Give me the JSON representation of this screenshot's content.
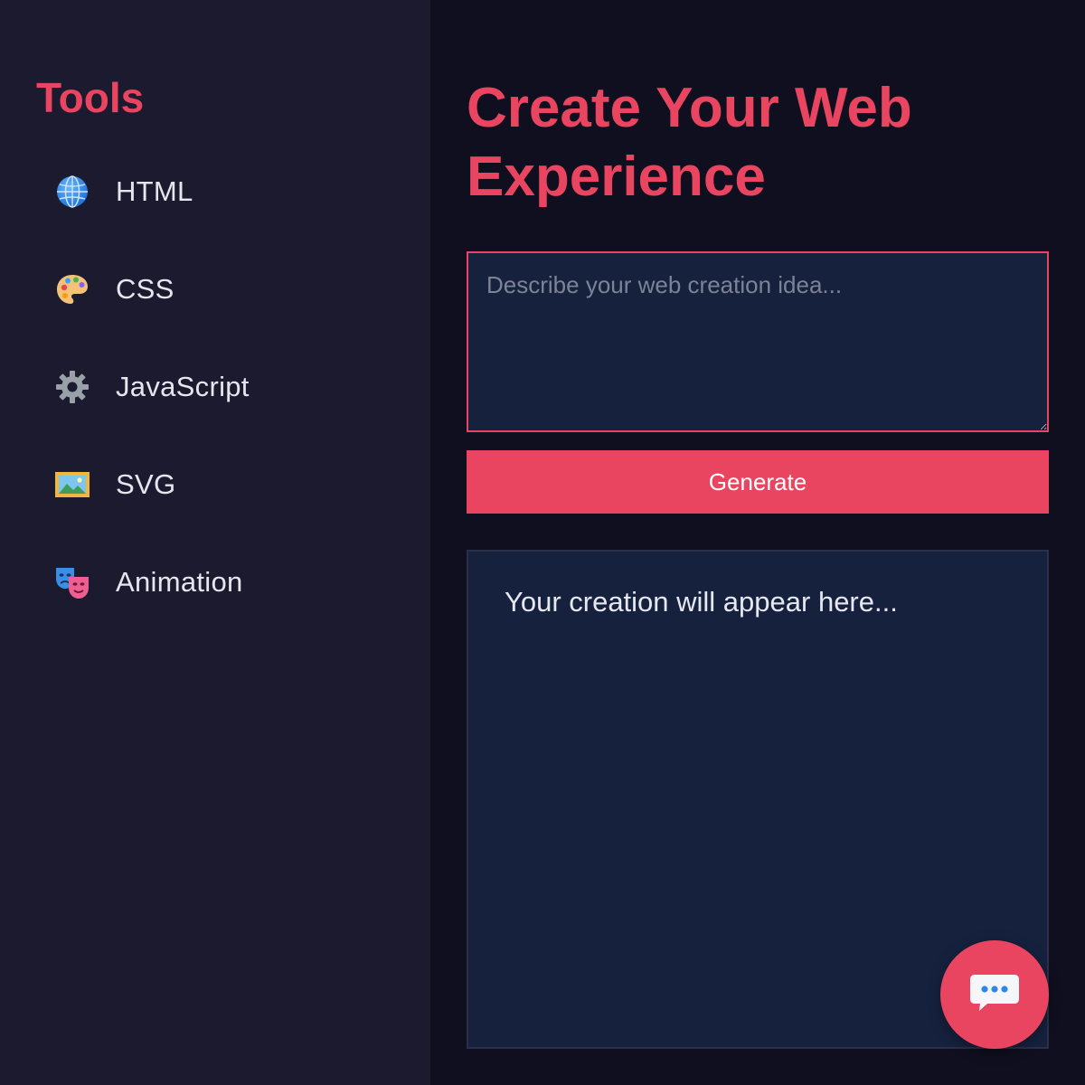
{
  "sidebar": {
    "title": "Tools",
    "items": [
      {
        "label": "HTML",
        "icon": "globe-icon"
      },
      {
        "label": "CSS",
        "icon": "palette-icon"
      },
      {
        "label": "JavaScript",
        "icon": "gear-icon"
      },
      {
        "label": "SVG",
        "icon": "framed-picture-icon"
      },
      {
        "label": "Animation",
        "icon": "theater-masks-icon"
      }
    ]
  },
  "main": {
    "title": "Create Your Web Experience",
    "prompt": {
      "placeholder": "Describe your web creation idea...",
      "value": ""
    },
    "generate_label": "Generate",
    "output_placeholder": "Your creation will appear here..."
  },
  "chat_button": {
    "icon": "speech-bubble-icon"
  },
  "colors": {
    "accent": "#e94560",
    "sidebar_bg": "#1b1a2f",
    "main_bg": "#0f0f1f",
    "panel_bg": "#16213e"
  }
}
